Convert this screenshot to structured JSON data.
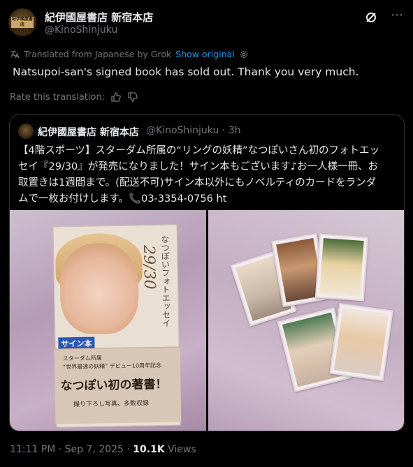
{
  "account": {
    "name": "紀伊國屋書店 新宿本店",
    "handle": "@KinoShinjuku",
    "avatar_text": "紀伊國屋書店 SHINJUKU"
  },
  "header_icons": [
    "grok-icon",
    "more-icon"
  ],
  "translation": {
    "label": "Translated from Japanese by Grok",
    "show_original": "Show original",
    "text": "Natsupoi-san's signed book has sold out. Thank you very much.",
    "rate_label": "Rate this translation:"
  },
  "quote": {
    "name": "紀伊國屋書店 新宿本店",
    "handle": "@KinoShinjuku · 3h",
    "text_lines": [
      "【4階スポーツ】スターダム所属の“リングの妖精”なつぽいさん初のフォトエッ",
      "セイ『29/30』が発売になりました！サイン本もございます♪お一人様一冊、お",
      "取置きは1週間まで。(配送不可)サイン本以外にもノベルティのカードをランダ",
      "ムで一枚お付けします。📞03-3354-0756 ht"
    ],
    "book": {
      "vertical_title": "なつぽいフォトエッセイ",
      "number": "29/30",
      "sign_sticker": "サイン本",
      "band_small_1": "スターダム所属",
      "band_small_2": "“世界最速の妖精” デビュー10周年記念",
      "band_title": "なつぽい初の著書！",
      "band_bottom": "撮り下ろし写真、多数収録"
    }
  },
  "meta": {
    "time": "11:11 PM · Sep 7, 2025 · ",
    "views_count": "10.1K",
    "views_label": " Views"
  }
}
